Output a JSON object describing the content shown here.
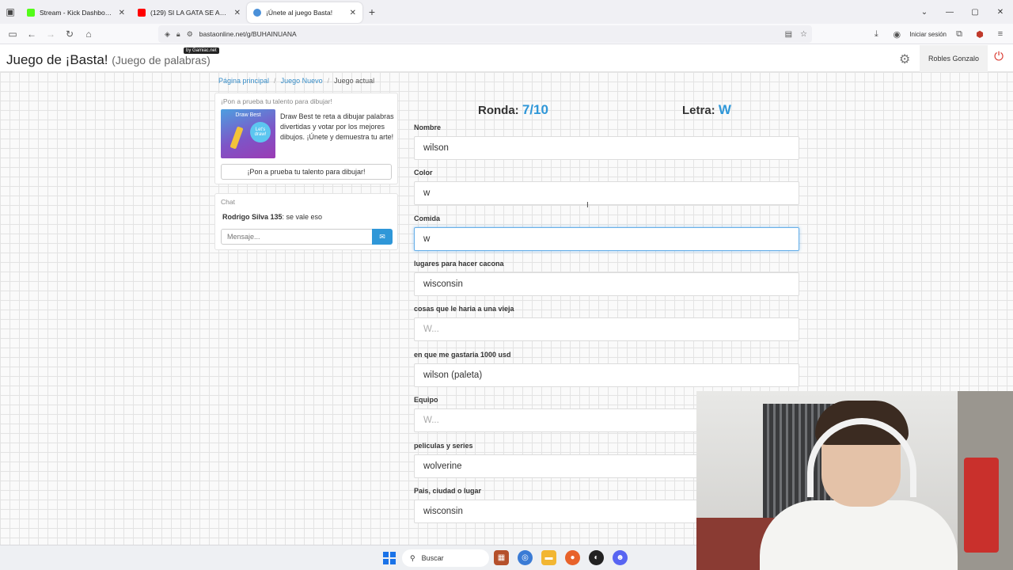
{
  "browser": {
    "tabs": [
      {
        "title": "Stream - Kick Dashboard",
        "color": "#53fc18",
        "active": false
      },
      {
        "title": "(129) SI LA GATA SE AMOTINA",
        "color": "#ff0000",
        "active": false
      },
      {
        "title": "¡Únete al juego Basta!",
        "color": "#4a90d9",
        "active": true
      }
    ],
    "url": "bastaonline.net/g/BUHAINUANA",
    "signin_label": "Iniciar sesión"
  },
  "site": {
    "logo_main": "Juego de ¡Basta!",
    "logo_sub": "(Juego de palabras)",
    "logo_badge": "by Gamiac.net",
    "user_name": "Robles Gonzalo"
  },
  "breadcrumb": {
    "home": "Página principal",
    "new_game": "Juego Nuevo",
    "current": "Juego actual"
  },
  "promo": {
    "title": "¡Pon a prueba tu talento para dibujar!",
    "image_title": "Draw Best",
    "image_bubble": "Let's draw!",
    "text": "Draw Best te reta a dibujar palabras divertidas y votar por los mejores dibujos. ¡Únete y demuestra tu arte!",
    "button": "¡Pon a prueba tu talento para dibujar!"
  },
  "chat": {
    "title": "Chat",
    "message_author": "Rodrigo Silva 135",
    "message_text": ": se vale eso",
    "input_placeholder": "Mensaje..."
  },
  "game": {
    "round_label": "Ronda:",
    "round_value": "7/10",
    "letter_label": "Letra:",
    "letter_value": "W",
    "fields": [
      {
        "label": "Nombre",
        "value": "wilson",
        "placeholder": "W..."
      },
      {
        "label": "Color",
        "value": "w",
        "placeholder": "W..."
      },
      {
        "label": "Comida",
        "value": "w",
        "placeholder": "W..."
      },
      {
        "label": "lugares para hacer cacona",
        "value": "wisconsin",
        "placeholder": "W..."
      },
      {
        "label": "cosas que le haria a una vieja",
        "value": "",
        "placeholder": "W..."
      },
      {
        "label": "en que me gastaria 1000 usd",
        "value": "wilson (paleta)",
        "placeholder": "W..."
      },
      {
        "label": "Equipo",
        "value": "",
        "placeholder": "W..."
      },
      {
        "label": "peliculas y series",
        "value": "wolverine",
        "placeholder": "W..."
      },
      {
        "label": "Pais, ciudad o lugar",
        "value": "wisconsin",
        "placeholder": "W..."
      }
    ]
  },
  "taskbar": {
    "search_label": "Buscar"
  }
}
